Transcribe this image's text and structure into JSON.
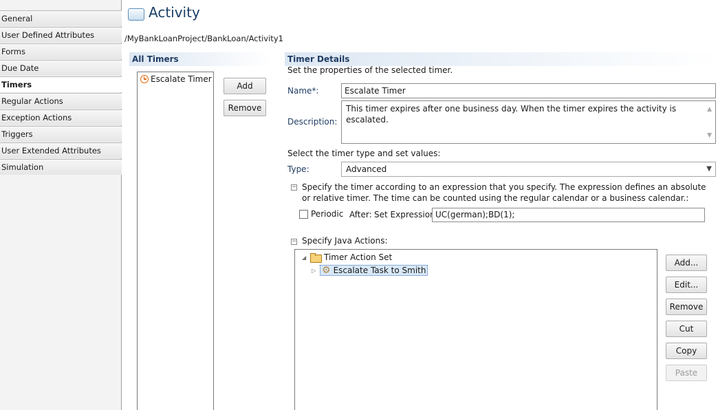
{
  "sidebar": {
    "tabs": [
      {
        "label": "General",
        "selected": false
      },
      {
        "label": "User Defined Attributes",
        "selected": false
      },
      {
        "label": "Forms",
        "selected": false
      },
      {
        "label": "Due Date",
        "selected": false
      },
      {
        "label": "Timers",
        "selected": true
      },
      {
        "label": "Regular Actions",
        "selected": false
      },
      {
        "label": "Exception Actions",
        "selected": false
      },
      {
        "label": "Triggers",
        "selected": false
      },
      {
        "label": "User Extended Attributes",
        "selected": false
      },
      {
        "label": "Simulation",
        "selected": false
      }
    ]
  },
  "header": {
    "title": "Activity",
    "breadcrumb": "/MyBankLoanProject/BankLoan/Activity1"
  },
  "all_timers": {
    "title": "All Timers",
    "items": [
      {
        "label": "Escalate Timer",
        "icon": "clock-icon"
      }
    ],
    "add_label": "Add",
    "remove_label": "Remove"
  },
  "timer_details": {
    "title": "Timer Details",
    "subtitle": "Set the properties of the selected timer.",
    "name_label": "Name*:",
    "name_value": "Escalate Timer",
    "description_label": "Description:",
    "description_value": "This timer expires after one business day. When the timer expires the activity is escalated.",
    "select_type_label": "Select the timer type and set values:",
    "type_label": "Type:",
    "type_value": "Advanced",
    "expression_section_text": "Specify the timer according to an expression that you specify. The expression defines an absolute or relative timer. The time can be counted using the regular calendar or a business calendar.:",
    "periodic_label": "Periodic",
    "periodic_checked": false,
    "after_label": "After:",
    "set_expression_label": "Set Expression:",
    "expression_value": "UC(german);BD(1);",
    "java_actions_label": "Specify Java Actions:",
    "tree": {
      "root": "Timer Action Set",
      "child": "Escalate Task to Smith"
    },
    "buttons": {
      "add": "Add...",
      "edit": "Edit...",
      "remove": "Remove",
      "cut": "Cut",
      "copy": "Copy",
      "paste": "Paste"
    }
  }
}
